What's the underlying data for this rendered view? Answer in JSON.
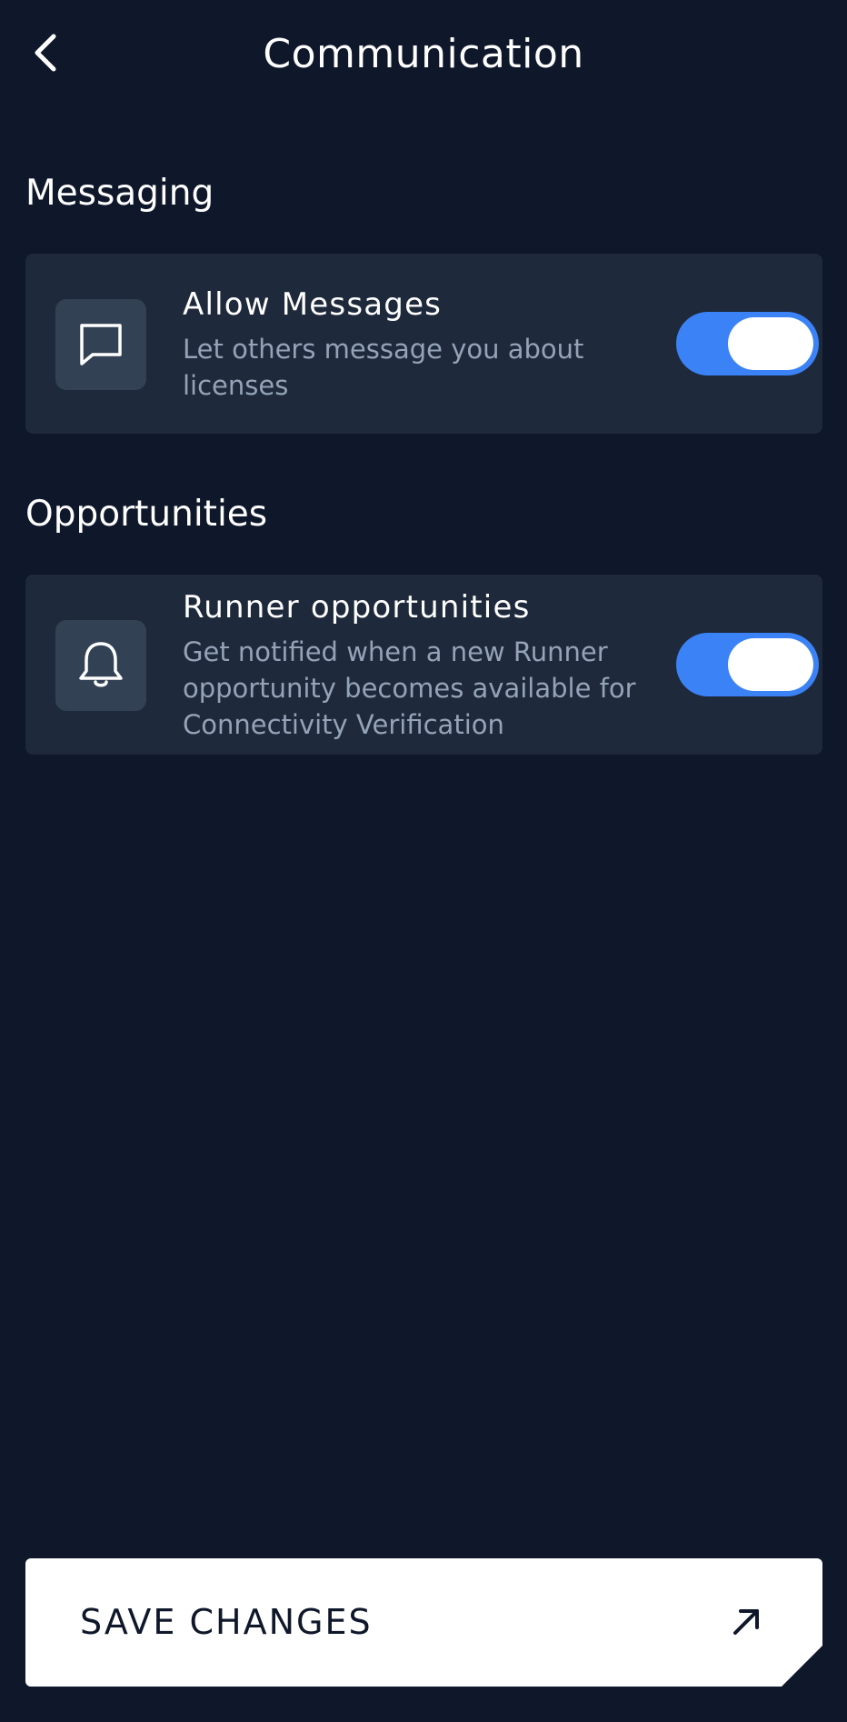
{
  "header": {
    "title": "Communication",
    "back_icon": "chevron-left-icon"
  },
  "sections": [
    {
      "title": "Messaging",
      "setting": {
        "icon": "chat-bubble-icon",
        "title": "Allow Messages",
        "description": "Let others message you about licenses",
        "enabled": true
      }
    },
    {
      "title": "Opportunities",
      "setting": {
        "icon": "bell-icon",
        "title": "Runner opportunities",
        "description": "Get notified when a new Runner opportunity becomes available for Connectivity Verification",
        "enabled": true
      }
    }
  ],
  "footer": {
    "save_label": "SAVE CHANGES",
    "save_icon": "arrow-up-right-icon"
  },
  "colors": {
    "background": "#0f172a",
    "card": "#1e293b",
    "icon_tile": "#334155",
    "toggle_on": "#3b82f6",
    "muted_text": "#94a3b8"
  }
}
